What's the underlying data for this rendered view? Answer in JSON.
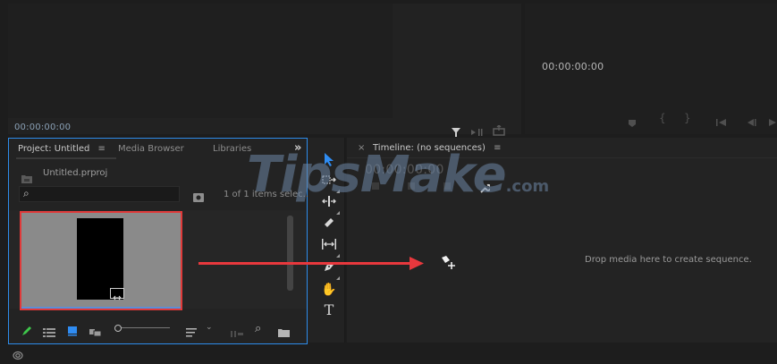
{
  "source_monitor": {
    "timecode": "00:00:00:00"
  },
  "program_monitor": {
    "timecode": "00:00:00:00"
  },
  "project_panel": {
    "tabs": [
      "Project: Untitled",
      "Media Browser",
      "Libraries"
    ],
    "more": "»",
    "file_name": "Untitled.prproj",
    "search_placeholder": "",
    "item_count": "1 of 1 items selec..."
  },
  "timeline": {
    "title": "Timeline: (no sequences)",
    "close": "×",
    "timecode": "00:00:00:00",
    "drop_hint": "Drop media here to create sequence."
  },
  "watermark": {
    "main": "TipsMake",
    "suffix": ".com"
  },
  "colors": {
    "panel_bg": "#232323",
    "panel_border_active": "#2d8ceb",
    "selection_red": "#e03a3a",
    "arrow_red": "#e8383d",
    "tool_selected": "#2f8cf2"
  },
  "icons": {
    "hamburger": "≡",
    "tool_type": "T",
    "tool_hand": "✋",
    "search": "⌕"
  }
}
